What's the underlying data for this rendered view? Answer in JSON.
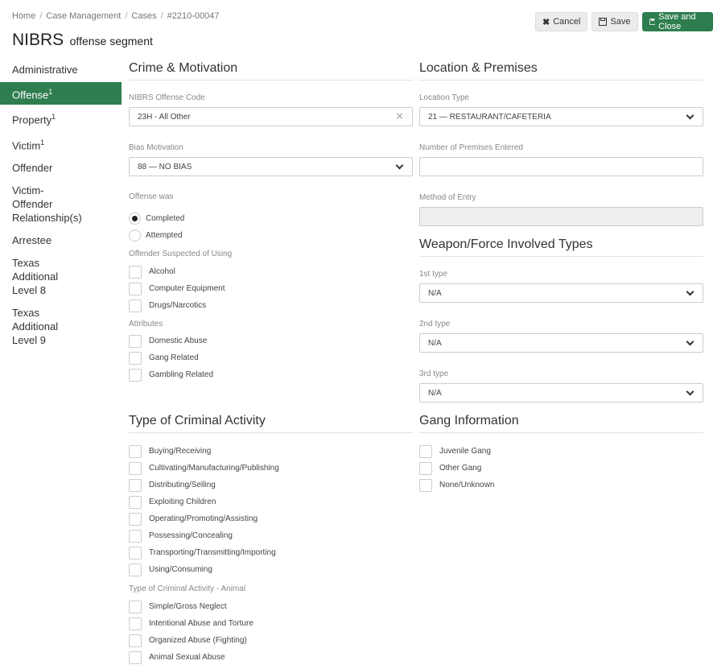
{
  "breadcrumb": [
    "Home",
    "Case Management",
    "Cases",
    "#2210-00047"
  ],
  "title": {
    "main": "NIBRS",
    "sub": "offense segment"
  },
  "toolbar": {
    "cancel": "Cancel",
    "save": "Save",
    "save_close": "Save and Close"
  },
  "nav": [
    {
      "label": "Administrative",
      "sup": ""
    },
    {
      "label": "Offense",
      "sup": "1"
    },
    {
      "label": "Property",
      "sup": "1"
    },
    {
      "label": "Victim",
      "sup": "1"
    },
    {
      "label": "Offender",
      "sup": ""
    },
    {
      "label": "Victim-Offender Relationship(s)",
      "sup": ""
    },
    {
      "label": "Arrestee",
      "sup": ""
    },
    {
      "label": "Texas Additional Level 8",
      "sup": ""
    },
    {
      "label": "Texas Additional Level 9",
      "sup": ""
    }
  ],
  "crime": {
    "heading": "Crime & Motivation",
    "offense_code_label": "NIBRS Offense Code",
    "offense_code_value": "23H - All Other",
    "bias_label": "Bias Motivation",
    "bias_value": "88 — NO BIAS",
    "offense_was_label": "Offense was",
    "completed": "Completed",
    "attempted": "Attempted",
    "suspected_label": "Offender Suspected of Using",
    "suspected": [
      "Alcohol",
      "Computer Equipment",
      "Drugs/Narcotics"
    ],
    "attributes_label": "Attributes",
    "attributes": [
      "Domestic Abuse",
      "Gang Related",
      "Gambling Related"
    ]
  },
  "location": {
    "heading": "Location & Premises",
    "type_label": "Location Type",
    "type_value": "21 — RESTAURANT/CAFETERIA",
    "premises_label": "Number of Premises Entered",
    "premises_value": "",
    "entry_label": "Method of Entry",
    "entry_value": ""
  },
  "weapon": {
    "heading": "Weapon/Force Involved Types",
    "first_label": "1st type",
    "first_value": "N/A",
    "second_label": "2nd type",
    "second_value": "N/A",
    "third_label": "3rd type",
    "third_value": "N/A"
  },
  "activity": {
    "heading": "Type of Criminal Activity",
    "items": [
      "Buying/Receiving",
      "Cultivating/Manufacturing/Publishing",
      "Distributing/Selling",
      "Exploiting Children",
      "Operating/Promoting/Assisting",
      "Possessing/Concealing",
      "Transporting/Transmitting/Importing",
      "Using/Consuming"
    ],
    "animal_label": "Type of Criminal Activity - Animal",
    "animal_items": [
      "Simple/Gross Neglect",
      "Intentional Abuse and Torture",
      "Organized Abuse (Fighting)",
      "Animal Sexual Abuse"
    ]
  },
  "gang": {
    "heading": "Gang Information",
    "items": [
      "Juvenile Gang",
      "Other Gang",
      "None/Unknown"
    ]
  },
  "colors": {
    "accent": "#2e7d4f"
  }
}
